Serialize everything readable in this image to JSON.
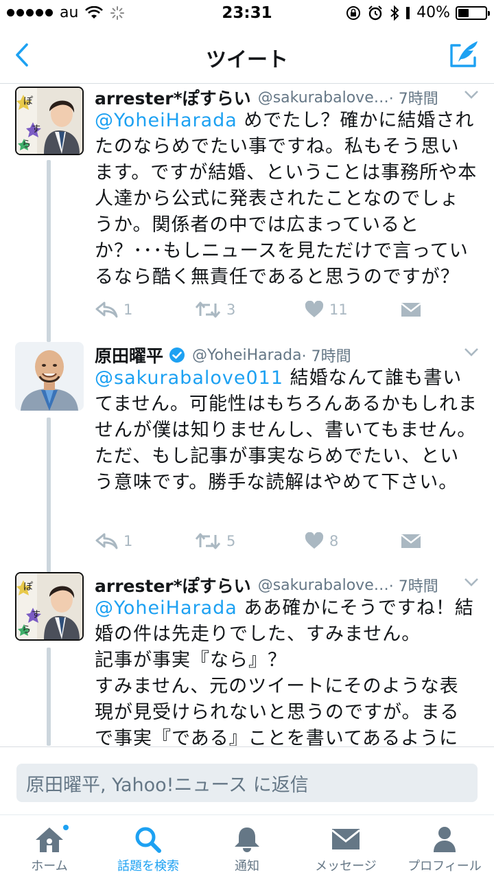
{
  "status_bar": {
    "carrier": "au",
    "time": "23:31",
    "battery": "40%",
    "battery_level": 0.4
  },
  "nav": {
    "title": "ツイート",
    "back_icon": "chevron-left-icon",
    "compose_icon": "compose-tweet-icon"
  },
  "tweets": [
    {
      "name": "arrester*ぽすらい",
      "handle": "@sakurabalove…",
      "time": "· 7時間",
      "verified": false,
      "mention": "@YoheiHarada",
      "text": " めでたし？確かに結婚されたのならめでたい事ですね。私もそう思います。ですが結婚、ということは事務所や本人達から公式に発表されたことなのでしょうか。関係者の中では広まっているとか？･･･もしニュースを見ただけで言っているなら酷く無責任であると思うのですが？",
      "replies": "1",
      "retweets": "3",
      "likes": "11"
    },
    {
      "name": "原田曜平",
      "handle": "@YoheiHarada",
      "time": "· 7時間",
      "verified": true,
      "mention": "@sakurabalove011",
      "text": " 結婚なんて誰も書いてません。可能性はもちろんあるかもしれませんが僕は知りませんし、書いてもません。ただ、もし記事が事実ならめでたい、という意味です。勝手な読解はやめて下さい。",
      "replies": "1",
      "retweets": "5",
      "likes": "8"
    },
    {
      "name": "arrester*ぽすらい",
      "handle": "@sakurabalove…",
      "time": "· 7時間",
      "verified": false,
      "mention": "@YoheiHarada",
      "text": " ああ確かにそうですね！結婚の件は先走りでした、すみません。",
      "text2": "記事が事実『なら』？",
      "text3": "すみません、元のツイートにそのような表現が見受けられないと思うのですが。まるで事実『である』ことを書いてあるように"
    }
  ],
  "reply_box": {
    "placeholder": "原田曜平, Yahoo!ニュース に返信"
  },
  "tab_bar": {
    "items": [
      {
        "label": "ホーム",
        "icon": "home-icon"
      },
      {
        "label": "話題を検索",
        "icon": "search-icon"
      },
      {
        "label": "通知",
        "icon": "bell-icon"
      },
      {
        "label": "メッセージ",
        "icon": "envelope-icon"
      },
      {
        "label": "プロフィール",
        "icon": "person-icon"
      }
    ],
    "active_index": 1
  },
  "colors": {
    "accent": "#1da1f2",
    "secondary_text": "#657786",
    "action_gray": "#aab8c2"
  }
}
